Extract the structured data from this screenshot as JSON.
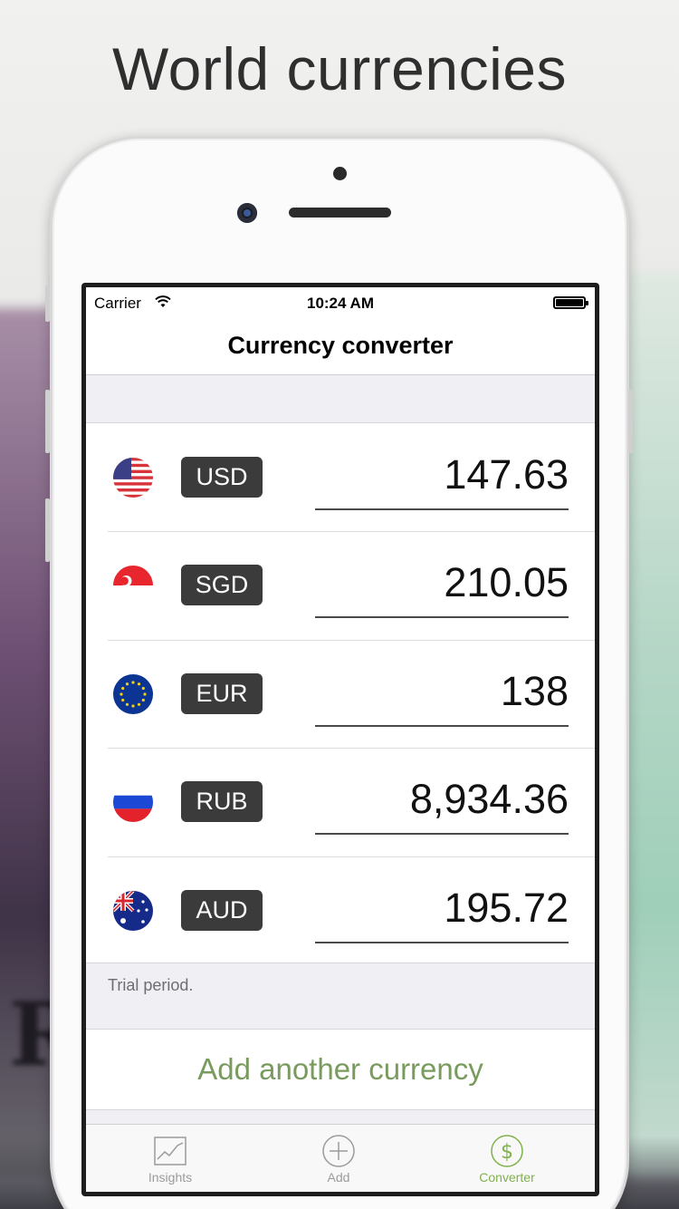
{
  "headline": "World currencies",
  "status_bar": {
    "carrier": "Carrier",
    "time": "10:24 AM"
  },
  "nav": {
    "title": "Currency converter"
  },
  "currencies": [
    {
      "code": "USD",
      "amount": "147.63",
      "flag": "us-flag-icon"
    },
    {
      "code": "SGD",
      "amount": "210.05",
      "flag": "sg-flag-icon"
    },
    {
      "code": "EUR",
      "amount": "138",
      "flag": "eu-flag-icon"
    },
    {
      "code": "RUB",
      "amount": "8,934.36",
      "flag": "ru-flag-icon"
    },
    {
      "code": "AUD",
      "amount": "195.72",
      "flag": "au-flag-icon"
    }
  ],
  "trial_note": "Trial period.",
  "add_currency_label": "Add another currency",
  "tabs": [
    {
      "label": "Insights",
      "icon": "chart-icon",
      "active": false
    },
    {
      "label": "Add",
      "icon": "plus-circle-icon",
      "active": false
    },
    {
      "label": "Converter",
      "icon": "dollar-circle-icon",
      "active": true
    }
  ],
  "colors": {
    "accent_green": "#7fb24a",
    "badge": "#3b3b3b",
    "add_link": "#7a9b5e"
  }
}
